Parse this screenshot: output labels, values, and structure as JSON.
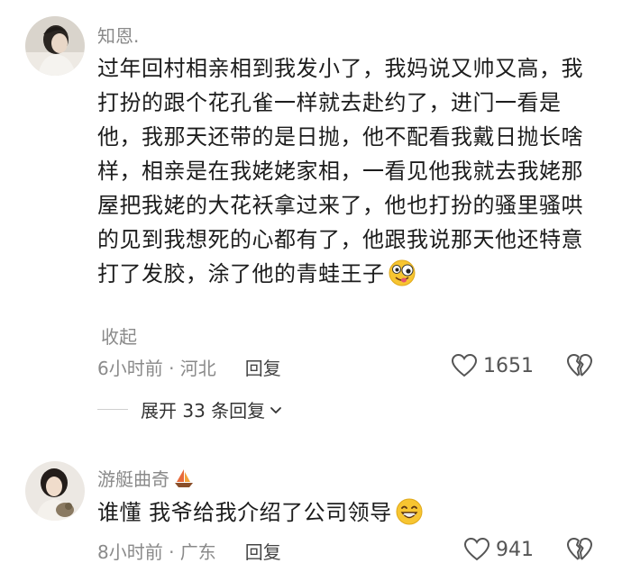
{
  "comments": [
    {
      "username": "知恩.",
      "text": "过年回村相亲相到我发小了，我妈说又帅又高，我打扮的跟个花孔雀一样就去赴约了，进门一看是他，我那天还带的是日抛，他不配看我戴日抛长啥样，相亲是在我姥姥家相，一看见他我就去我姥那屋把我姥的大花袄拿过来了，他也打扮的骚里骚哄的见到我想死的心都有了，他跟我说那天他还特意打了发胶，涂了他的青蛙王子",
      "collapse_label": "收起",
      "time_location": "6小时前 · 河北",
      "reply_label": "回复",
      "likes": "1651",
      "expand_label": "展开 33 条回复"
    },
    {
      "username": "游艇曲奇",
      "text": "谁懂 我爷给我介绍了公司领导",
      "time_location": "8小时前 · 广东",
      "reply_label": "回复",
      "likes": "941"
    }
  ],
  "colors": {
    "meta_gray": "#8a8a8a",
    "text_dark": "#1c1c1c",
    "emoji_yellow": "#f7c531"
  },
  "icons": [
    "heart-outline-icon",
    "broken-heart-icon",
    "chevron-down-icon",
    "sailboat-icon",
    "silly-face-emoji",
    "grin-emoji"
  ]
}
